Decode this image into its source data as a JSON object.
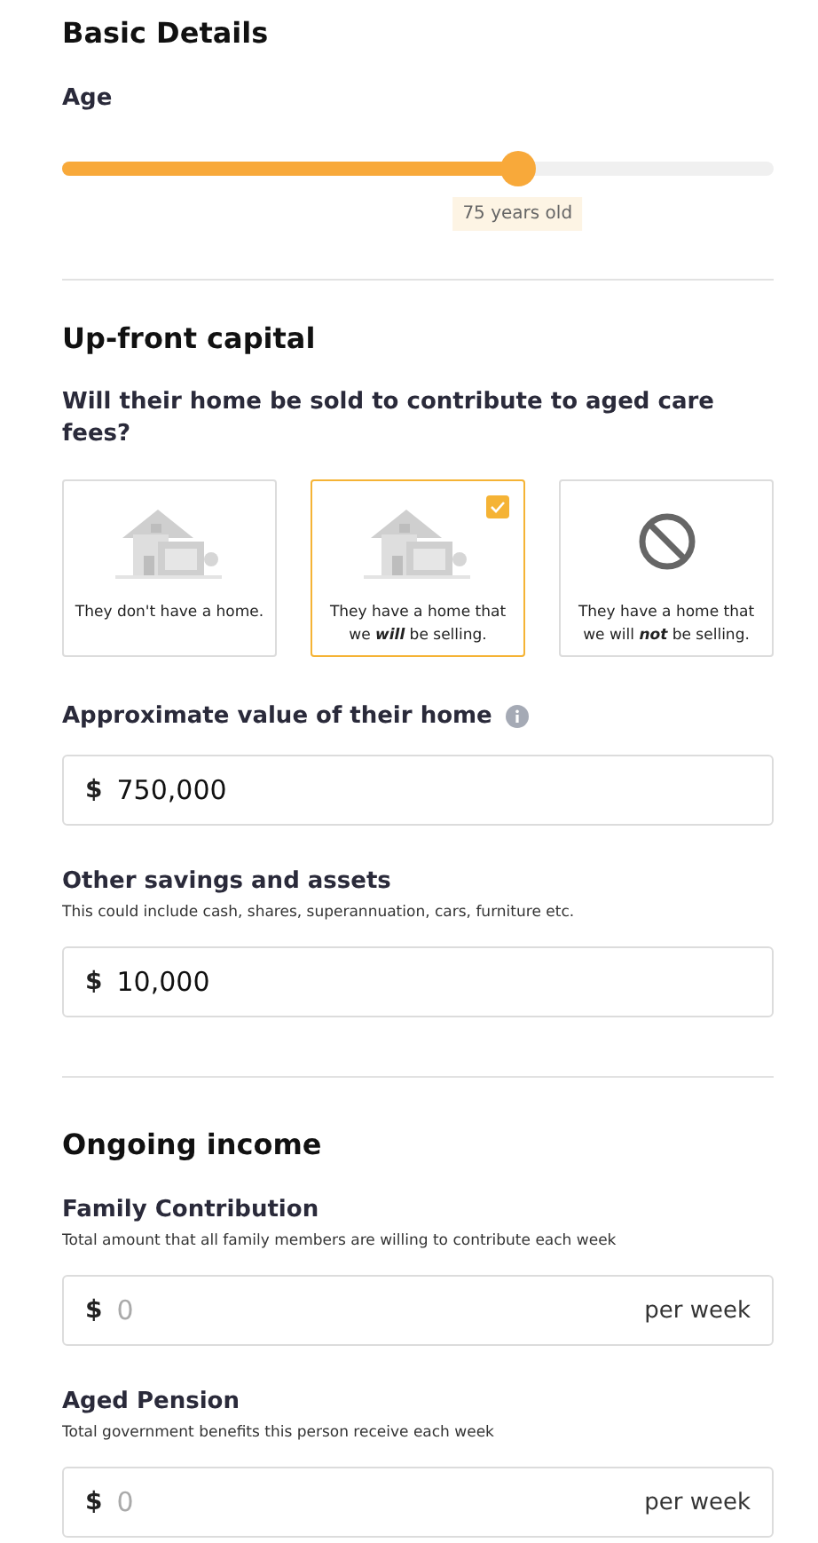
{
  "basic_details": {
    "title": "Basic Details",
    "age": {
      "label": "Age",
      "level": 0.64,
      "reading": "75 years old"
    }
  },
  "upfront_capital": {
    "title": "Up-front capital",
    "question": "Will their home be sold to contribute to aged care fees?",
    "options": [
      {
        "kind": "house",
        "text": "They don't have a home.",
        "selected": false
      },
      {
        "kind": "house",
        "text": "They have a home that we **will** be selling.",
        "selected": true
      },
      {
        "kind": "none",
        "text": "They have a home that we will **not** be selling.",
        "selected": false
      }
    ],
    "fields": [
      {
        "label": "Approximate value of their home",
        "info": true,
        "prefix": "$",
        "value": "750,000"
      },
      {
        "label": "Other savings and assets",
        "hint": "This could include cash, shares, superannuation, cars, furniture etc.",
        "prefix": "$",
        "value": "10,000"
      }
    ]
  },
  "ongoing_income": {
    "title": "Ongoing income",
    "fields": [
      {
        "label": "Family Contribution",
        "hint": "Total amount that all family members are willing to contribute each week",
        "prefix": "$",
        "placeholder": "0",
        "suffix": "per week"
      },
      {
        "label": "Aged Pension",
        "hint": "Total government benefits this person receive each week",
        "prefix": "$",
        "placeholder": "0",
        "suffix": "per week"
      }
    ]
  }
}
